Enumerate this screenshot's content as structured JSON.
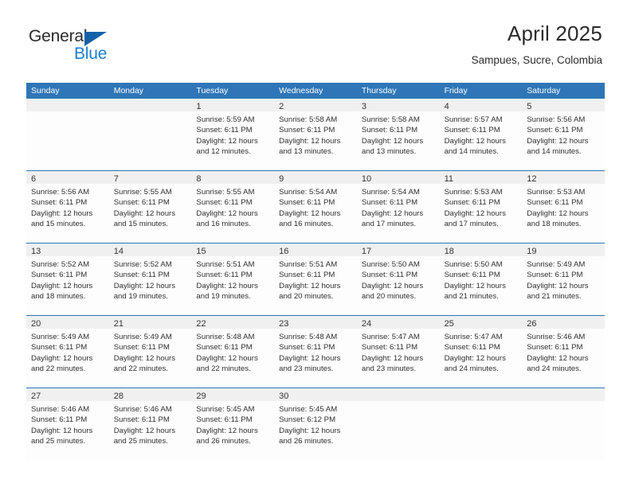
{
  "logo": {
    "word_one": "General",
    "word_two": "Blue",
    "triangle_color": "#1461a8",
    "blue_text_color": "#1d7fd0"
  },
  "header": {
    "title": "April 2025",
    "subtitle": "Sampues, Sucre, Colombia"
  },
  "theme": {
    "header_blue": "#2e76b8",
    "daynum_band": "#f0f0f0",
    "cell_background": "#fdfdfd",
    "text": "#303030"
  },
  "weekdays": [
    "Sunday",
    "Monday",
    "Tuesday",
    "Wednesday",
    "Thursday",
    "Friday",
    "Saturday"
  ],
  "weeks": [
    [
      {
        "day": "",
        "lines": []
      },
      {
        "day": "",
        "lines": []
      },
      {
        "day": "1",
        "lines": [
          "Sunrise: 5:59 AM",
          "Sunset: 6:11 PM",
          "Daylight: 12 hours",
          "and 12 minutes."
        ]
      },
      {
        "day": "2",
        "lines": [
          "Sunrise: 5:58 AM",
          "Sunset: 6:11 PM",
          "Daylight: 12 hours",
          "and 13 minutes."
        ]
      },
      {
        "day": "3",
        "lines": [
          "Sunrise: 5:58 AM",
          "Sunset: 6:11 PM",
          "Daylight: 12 hours",
          "and 13 minutes."
        ]
      },
      {
        "day": "4",
        "lines": [
          "Sunrise: 5:57 AM",
          "Sunset: 6:11 PM",
          "Daylight: 12 hours",
          "and 14 minutes."
        ]
      },
      {
        "day": "5",
        "lines": [
          "Sunrise: 5:56 AM",
          "Sunset: 6:11 PM",
          "Daylight: 12 hours",
          "and 14 minutes."
        ]
      }
    ],
    [
      {
        "day": "6",
        "lines": [
          "Sunrise: 5:56 AM",
          "Sunset: 6:11 PM",
          "Daylight: 12 hours",
          "and 15 minutes."
        ]
      },
      {
        "day": "7",
        "lines": [
          "Sunrise: 5:55 AM",
          "Sunset: 6:11 PM",
          "Daylight: 12 hours",
          "and 15 minutes."
        ]
      },
      {
        "day": "8",
        "lines": [
          "Sunrise: 5:55 AM",
          "Sunset: 6:11 PM",
          "Daylight: 12 hours",
          "and 16 minutes."
        ]
      },
      {
        "day": "9",
        "lines": [
          "Sunrise: 5:54 AM",
          "Sunset: 6:11 PM",
          "Daylight: 12 hours",
          "and 16 minutes."
        ]
      },
      {
        "day": "10",
        "lines": [
          "Sunrise: 5:54 AM",
          "Sunset: 6:11 PM",
          "Daylight: 12 hours",
          "and 17 minutes."
        ]
      },
      {
        "day": "11",
        "lines": [
          "Sunrise: 5:53 AM",
          "Sunset: 6:11 PM",
          "Daylight: 12 hours",
          "and 17 minutes."
        ]
      },
      {
        "day": "12",
        "lines": [
          "Sunrise: 5:53 AM",
          "Sunset: 6:11 PM",
          "Daylight: 12 hours",
          "and 18 minutes."
        ]
      }
    ],
    [
      {
        "day": "13",
        "lines": [
          "Sunrise: 5:52 AM",
          "Sunset: 6:11 PM",
          "Daylight: 12 hours",
          "and 18 minutes."
        ]
      },
      {
        "day": "14",
        "lines": [
          "Sunrise: 5:52 AM",
          "Sunset: 6:11 PM",
          "Daylight: 12 hours",
          "and 19 minutes."
        ]
      },
      {
        "day": "15",
        "lines": [
          "Sunrise: 5:51 AM",
          "Sunset: 6:11 PM",
          "Daylight: 12 hours",
          "and 19 minutes."
        ]
      },
      {
        "day": "16",
        "lines": [
          "Sunrise: 5:51 AM",
          "Sunset: 6:11 PM",
          "Daylight: 12 hours",
          "and 20 minutes."
        ]
      },
      {
        "day": "17",
        "lines": [
          "Sunrise: 5:50 AM",
          "Sunset: 6:11 PM",
          "Daylight: 12 hours",
          "and 20 minutes."
        ]
      },
      {
        "day": "18",
        "lines": [
          "Sunrise: 5:50 AM",
          "Sunset: 6:11 PM",
          "Daylight: 12 hours",
          "and 21 minutes."
        ]
      },
      {
        "day": "19",
        "lines": [
          "Sunrise: 5:49 AM",
          "Sunset: 6:11 PM",
          "Daylight: 12 hours",
          "and 21 minutes."
        ]
      }
    ],
    [
      {
        "day": "20",
        "lines": [
          "Sunrise: 5:49 AM",
          "Sunset: 6:11 PM",
          "Daylight: 12 hours",
          "and 22 minutes."
        ]
      },
      {
        "day": "21",
        "lines": [
          "Sunrise: 5:49 AM",
          "Sunset: 6:11 PM",
          "Daylight: 12 hours",
          "and 22 minutes."
        ]
      },
      {
        "day": "22",
        "lines": [
          "Sunrise: 5:48 AM",
          "Sunset: 6:11 PM",
          "Daylight: 12 hours",
          "and 22 minutes."
        ]
      },
      {
        "day": "23",
        "lines": [
          "Sunrise: 5:48 AM",
          "Sunset: 6:11 PM",
          "Daylight: 12 hours",
          "and 23 minutes."
        ]
      },
      {
        "day": "24",
        "lines": [
          "Sunrise: 5:47 AM",
          "Sunset: 6:11 PM",
          "Daylight: 12 hours",
          "and 23 minutes."
        ]
      },
      {
        "day": "25",
        "lines": [
          "Sunrise: 5:47 AM",
          "Sunset: 6:11 PM",
          "Daylight: 12 hours",
          "and 24 minutes."
        ]
      },
      {
        "day": "26",
        "lines": [
          "Sunrise: 5:46 AM",
          "Sunset: 6:11 PM",
          "Daylight: 12 hours",
          "and 24 minutes."
        ]
      }
    ],
    [
      {
        "day": "27",
        "lines": [
          "Sunrise: 5:46 AM",
          "Sunset: 6:11 PM",
          "Daylight: 12 hours",
          "and 25 minutes."
        ]
      },
      {
        "day": "28",
        "lines": [
          "Sunrise: 5:46 AM",
          "Sunset: 6:11 PM",
          "Daylight: 12 hours",
          "and 25 minutes."
        ]
      },
      {
        "day": "29",
        "lines": [
          "Sunrise: 5:45 AM",
          "Sunset: 6:11 PM",
          "Daylight: 12 hours",
          "and 26 minutes."
        ]
      },
      {
        "day": "30",
        "lines": [
          "Sunrise: 5:45 AM",
          "Sunset: 6:12 PM",
          "Daylight: 12 hours",
          "and 26 minutes."
        ]
      },
      {
        "day": "",
        "lines": []
      },
      {
        "day": "",
        "lines": []
      },
      {
        "day": "",
        "lines": []
      }
    ]
  ]
}
